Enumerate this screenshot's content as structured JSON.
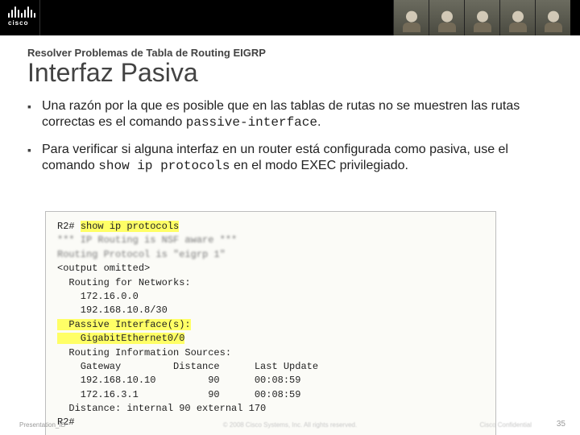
{
  "brand": {
    "name": "cisco"
  },
  "kicker": "Resolver Problemas de Tabla de Routing EIGRP",
  "title": "Interfaz Pasiva",
  "bullets": {
    "b1_pre": "Una razón por la que es posible que en las tablas de rutas no se muestren las rutas correctas es el comando ",
    "b1_code": "passive-interface",
    "b1_post": ".",
    "b2_pre": "Para verificar si alguna interfaz en un router está configurada como pasiva, use el comando ",
    "b2_code": "show ip protocols",
    "b2_post": " en el modo EXEC privilegiado."
  },
  "terminal": {
    "l01_prompt": "R2# ",
    "l01_cmd": "show ip protocols",
    "l02": "*** IP Routing is NSF aware ***",
    "l03": "Routing Protocol is \"eigrp 1\"",
    "l04": "<output omitted>",
    "l05": "  Routing for Networks:",
    "l06": "    172.16.0.0",
    "l07": "    192.168.10.8/30",
    "l08": "  Passive Interface(s):",
    "l09": "    GigabitEthernet0/0",
    "l10": "  Routing Information Sources:",
    "l11": "    Gateway         Distance      Last Update",
    "l12": "    192.168.10.10         90      00:08:59",
    "l13": "    172.16.3.1            90      00:08:59",
    "l14": "  Distance: internal 90 external 170",
    "l15": "R2#"
  },
  "footer": {
    "id": "Presentation_ID",
    "copyright": "© 2008 Cisco Systems, Inc. All rights reserved.",
    "confidential": "Cisco Confidential",
    "pagenum": "35"
  }
}
